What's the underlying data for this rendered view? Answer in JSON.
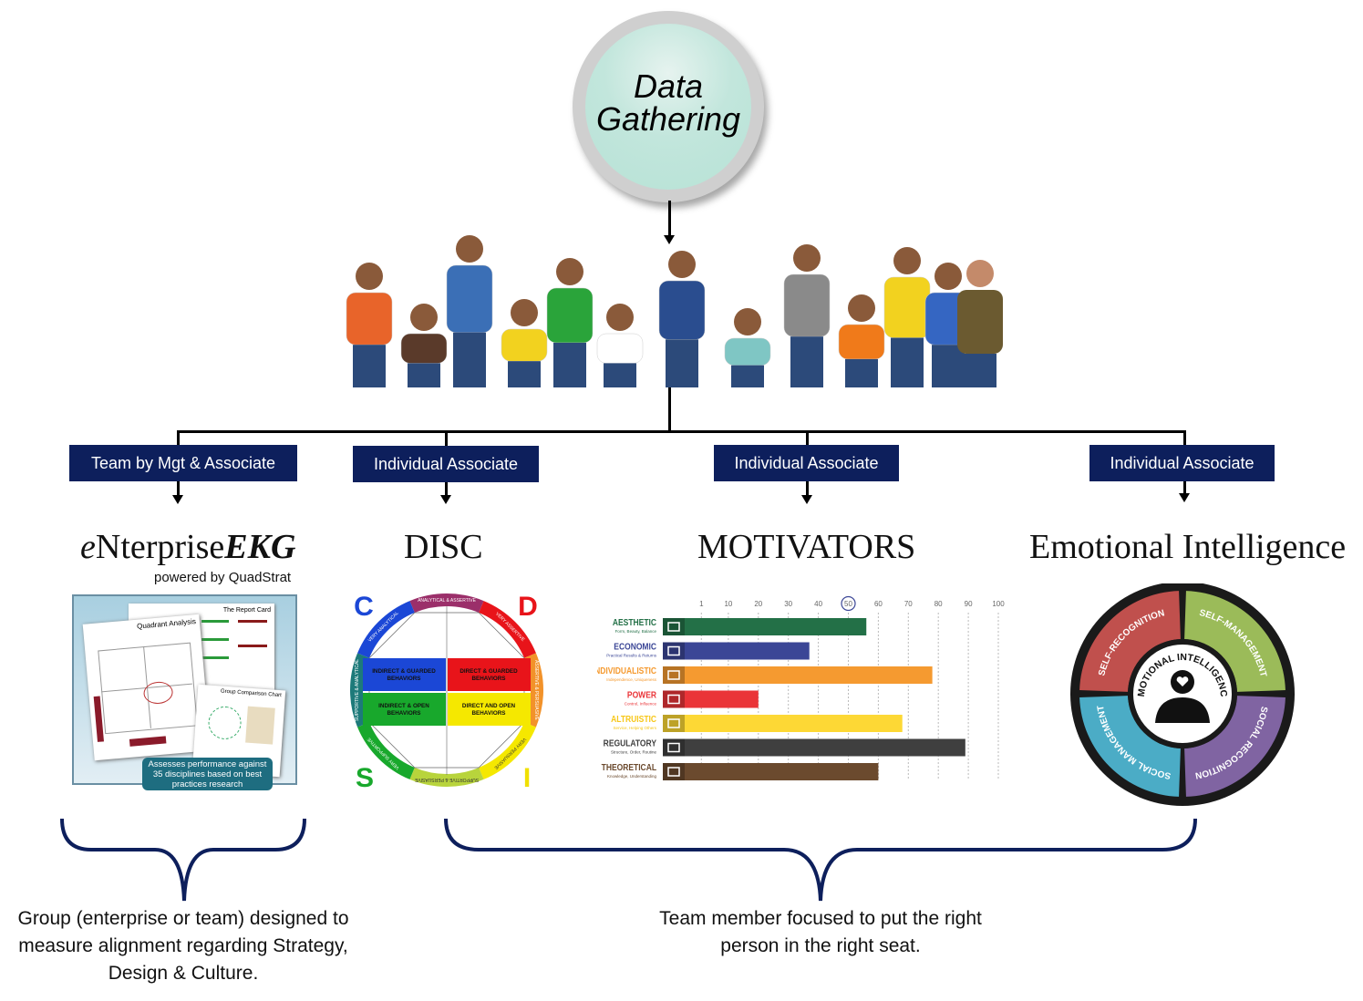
{
  "hub": {
    "label": "Data\nGathering"
  },
  "people": {
    "shirt_colors": [
      "#e8642a",
      "#5a3a2a",
      "#3b6fb6",
      "#f2d21f",
      "#2aa43a",
      "#ffffff",
      "#2a4d8f",
      "#7fc6c4",
      "#8a8a8a",
      "#f07a1a",
      "#f2d21f",
      "#3566c2",
      "#6b5a30"
    ]
  },
  "branches": [
    {
      "label": "Team by Mgt & Associate",
      "title_prefix": "e",
      "title_main": "Nterprise",
      "title_bold": "EKG",
      "subtitle": "powered by QuadStrat"
    },
    {
      "label": "Individual Associate",
      "title": "DISC"
    },
    {
      "label": "Individual Associate",
      "title": "MOTIVATORS"
    },
    {
      "label": "Individual Associate",
      "title": "Emotional Intelligence"
    }
  ],
  "ekg_image": {
    "report_title": "The Report Card",
    "quadrant_title": "Quadrant Analysis",
    "group_title": "Group Comparison Chart",
    "badge": "Assesses performance against 35 disciplines based on best practices research"
  },
  "disc": {
    "letters": {
      "c": "C",
      "d": "D",
      "s": "S",
      "i": "I"
    },
    "quadrants": [
      "INDIRECT & GUARDED BEHAVIORS",
      "DIRECT & GUARDED BEHAVIORS",
      "INDIRECT & OPEN BEHAVIORS",
      "DIRECT AND OPEN BEHAVIORS"
    ],
    "ring": [
      "ANALYTICAL & ASSERTIVE",
      "VERY ASSERTIVE",
      "ASSERTIVE & PERSUASIVE",
      "VERY PERSUASIVE",
      "SUPPORTIVE & PERSUASIVE",
      "VERY SUPPORTIVE",
      "SUPPORTIVE & ANALYTICAL",
      "VERY ANALYTICAL"
    ],
    "colors": {
      "c": "#1b47d6",
      "d": "#e8141a",
      "s": "#18a82c",
      "i": "#f5e800"
    }
  },
  "chart_data": {
    "type": "bar",
    "orientation": "horizontal",
    "categories": [
      "AESTHETIC",
      "ECONOMIC",
      "INDIVIDUALISTIC",
      "POWER",
      "ALTRUISTIC",
      "REGULATORY",
      "THEORETICAL"
    ],
    "subtitles": [
      "Form, Beauty, Balance",
      "Practical Results & Returns",
      "Independence, Uniqueness",
      "Control, Influence",
      "Service, Helping Others",
      "Structure, Order, Routine",
      "Knowledge, Understanding"
    ],
    "values": [
      56,
      37,
      78,
      20,
      68,
      89,
      60
    ],
    "colors": [
      "#237047",
      "#3b4696",
      "#f59a30",
      "#ea3438",
      "#fdd835",
      "#3f3f3f",
      "#6b4a2e"
    ],
    "label_colors": [
      "#237047",
      "#3b4696",
      "#f59a30",
      "#ea3438",
      "#f7c71a",
      "#3f3f3f",
      "#6b4a2e"
    ],
    "icons": [
      "puzzle-icon",
      "growth-chart-icon",
      "person-cheer-icon",
      "podium-icon",
      "handshake-icon",
      "shield-icon",
      "brain-head-icon"
    ],
    "tick_labels": [
      "1",
      "10",
      "20",
      "30",
      "40",
      "50",
      "60",
      "70",
      "80",
      "90",
      "100"
    ],
    "highlighted_tick": "50",
    "xlim": [
      0,
      100
    ],
    "grid": true
  },
  "ei": {
    "center": "EMOTIONAL INTELLIGENCE",
    "segments": [
      {
        "label": "SELF-RECOGNITION",
        "color": "#c0504d"
      },
      {
        "label": "SELF-MANAGEMENT",
        "color": "#9bbb59"
      },
      {
        "label": "SOCIAL RECOGNITION",
        "color": "#8064a2"
      },
      {
        "label": "SOCIAL MANAGEMENT",
        "color": "#4bacc6"
      }
    ]
  },
  "captions": {
    "left": "Group (enterprise or team) designed to measure alignment regarding Strategy, Design & Culture.",
    "right": "Team member focused to put the right person in the right seat."
  }
}
